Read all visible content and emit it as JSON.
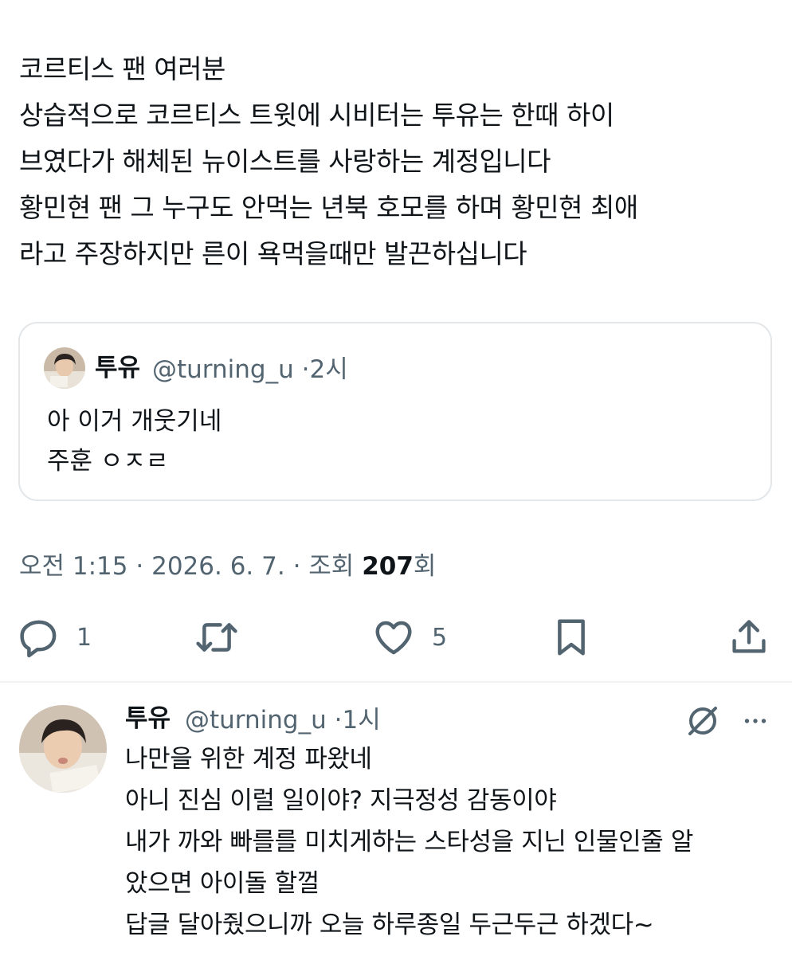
{
  "post": {
    "text_lines": [
      "코르티스 팬 여러분",
      "상습적으로 코르티스 트윗에 시비터는 투유는 한때 하이",
      "브였다가 해체된 뉴이스트를 사랑하는 계정입니다",
      "황민현 팬 그 누구도 안먹는 년북 호모를 하며 황민현 최애",
      "라고 주장하지만 른이 욕먹을때만 발끈하십니다"
    ]
  },
  "quoted": {
    "name": "투유",
    "handle": "@turning_u",
    "separator": "·",
    "time": "2시",
    "lines": [
      "아 이거 개웃기네",
      "주훈 ㅇㅈㄹ"
    ]
  },
  "timestamp": {
    "time": "오전 1:15",
    "date": "2026. 6. 7.",
    "views_prefix": "조회",
    "views_count": "207",
    "views_suffix": "회",
    "sep": "·"
  },
  "actions": {
    "reply_icon": "reply-icon",
    "reply_count": "1",
    "retweet_icon": "retweet-icon",
    "like_icon": "heart-icon",
    "like_count": "5",
    "bookmark_icon": "bookmark-icon",
    "share_icon": "share-icon"
  },
  "reply": {
    "name": "투유",
    "handle": "@turning_u",
    "separator": "·",
    "time": "1시",
    "lines": [
      "나만을 위한 계정 파왔네",
      "아니 진심 이럴 일이야? 지극정성 감동이야",
      "내가 까와 빠를를 미치게하는 스타성을 지닌 인물인줄 알",
      "았으면 아이돌 할껄",
      "답글 달아줬으니까 오늘 하루종일 두근두근 하겠다~"
    ]
  },
  "colors": {
    "text": "#0f1419",
    "secondary": "#536471",
    "border": "#e3e7ea"
  }
}
